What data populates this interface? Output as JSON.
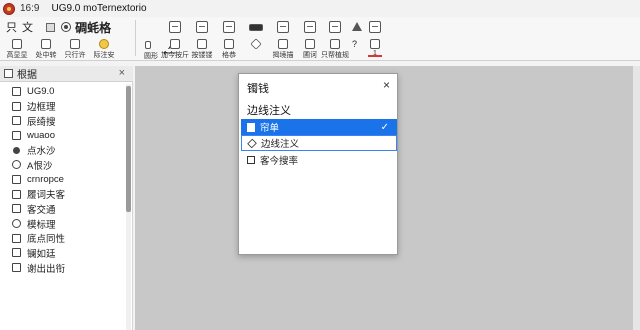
{
  "titlebar": {
    "aspect": "16:9",
    "title": "UG9.0  moTernextorio"
  },
  "toolbar": {
    "menu_label": "只 文",
    "bold_label": "碉蚝格",
    "tools": [
      {
        "name": "tool-view",
        "label": "高显显",
        "icon": "grid-icon"
      },
      {
        "name": "tool-sketch",
        "label": "处中转",
        "icon": "sketch-icon"
      },
      {
        "name": "tool-feature",
        "label": "只行许",
        "icon": "feature-icon"
      },
      {
        "name": "tool-bulb",
        "label": "际注安",
        "icon": "bulb-icon"
      },
      {
        "name": "tool-small",
        "label": "圆形",
        "icon": "small-icon"
      },
      {
        "name": "tool-measure",
        "label": "",
        "icon": "measure-icon"
      },
      {
        "name": "tool-add",
        "label": "加今按斤",
        "icon": "add-icon"
      },
      {
        "name": "tool-camera",
        "label": "按镂镂",
        "icon": "camera-icon"
      },
      {
        "name": "tool-display",
        "label": "格恭",
        "icon": "display-icon"
      },
      {
        "name": "tool-align",
        "label": "揭境描",
        "icon": "align-icon"
      },
      {
        "name": "tool-note",
        "label": "圃诃",
        "icon": "note-icon"
      },
      {
        "name": "tool-print",
        "label": "只帮植规",
        "icon": "print-icon"
      },
      {
        "name": "tool-help",
        "label": "?",
        "icon": "help-icon"
      },
      {
        "name": "tool-page",
        "label": "1",
        "icon": "page-icon"
      }
    ]
  },
  "panel": {
    "title": "根据",
    "items": [
      {
        "label": "UG9.0",
        "icon": "box"
      },
      {
        "label": "边框理",
        "icon": "box"
      },
      {
        "label": "辰绮搜",
        "icon": "box"
      },
      {
        "label": "wuaoo",
        "icon": "box"
      },
      {
        "label": "点水沙",
        "icon": "dot"
      },
      {
        "label": "A恨沙",
        "icon": "round"
      },
      {
        "label": "crnropce",
        "icon": "box"
      },
      {
        "label": "履词夫客",
        "icon": "box"
      },
      {
        "label": "客交通",
        "icon": "box"
      },
      {
        "label": "模标理",
        "icon": "round"
      },
      {
        "label": "底点同性",
        "icon": "box"
      },
      {
        "label": "镧如廷",
        "icon": "box"
      },
      {
        "label": "谢出出衔",
        "icon": "box"
      }
    ]
  },
  "dialog": {
    "title": "镯钱",
    "close": "×",
    "label": "边线注义",
    "options": [
      {
        "label": "帘单",
        "selected": true,
        "check": "✓"
      },
      {
        "label": "边线注义",
        "selected": false
      },
      {
        "label": "客今搜率",
        "selected": false
      }
    ]
  }
}
